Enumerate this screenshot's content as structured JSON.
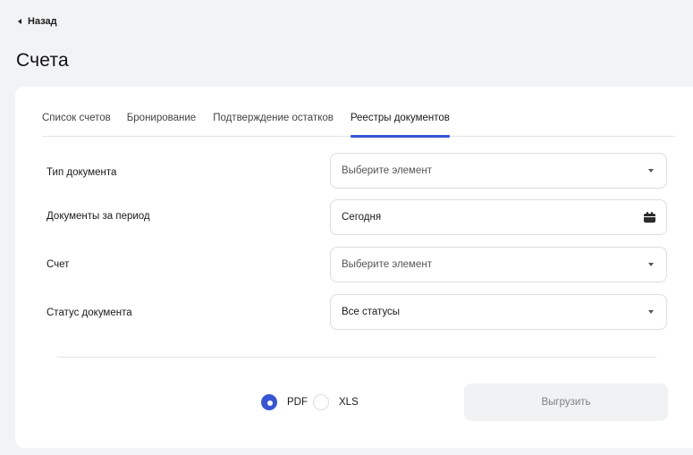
{
  "back_label": "Назад",
  "page_title": "Счета",
  "tabs": [
    {
      "label": "Список счетов",
      "active": false
    },
    {
      "label": "Бронирование",
      "active": false
    },
    {
      "label": "Подтверждение остатков",
      "active": false
    },
    {
      "label": "Реестры документов",
      "active": true
    }
  ],
  "form": {
    "doc_type": {
      "label": "Тип документа",
      "value": "Выберите элемент"
    },
    "period": {
      "label": "Документы за период",
      "value": "Сегодня",
      "icon": "calendar-icon"
    },
    "account": {
      "label": "Счет",
      "value": "Выберите элемент"
    },
    "status": {
      "label": "Статус документа",
      "value": "Все статусы"
    }
  },
  "format": {
    "options": [
      "PDF",
      "XLS"
    ],
    "selected": "PDF"
  },
  "export_label": "Выгрузить",
  "colors": {
    "accent": "#3655d6",
    "background": "#f2f3f5",
    "card": "#ffffff",
    "disabled_button": "#f1f2f4"
  }
}
